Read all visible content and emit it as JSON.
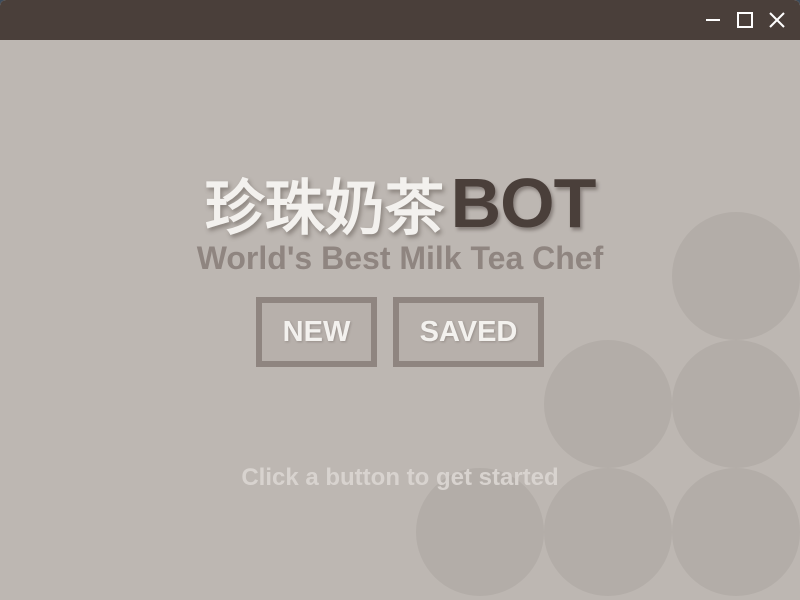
{
  "window": {
    "controls": {
      "minimize_icon": "minimize-icon",
      "maximize_icon": "maximize-icon",
      "close_icon": "close-icon"
    }
  },
  "header": {
    "title_chinese": "珍珠奶茶",
    "title_latin": "BOT",
    "subtitle": "World's Best Milk Tea Chef"
  },
  "menu": {
    "new_label": "NEW",
    "saved_label": "SAVED"
  },
  "hint": "Click a button to get started",
  "colors": {
    "background": "#bdb7b2",
    "titlebar": "#4a3f3a",
    "accent_dark": "#4a3f3a",
    "button_border": "#8f8580",
    "text_light": "#f3f1ee"
  }
}
